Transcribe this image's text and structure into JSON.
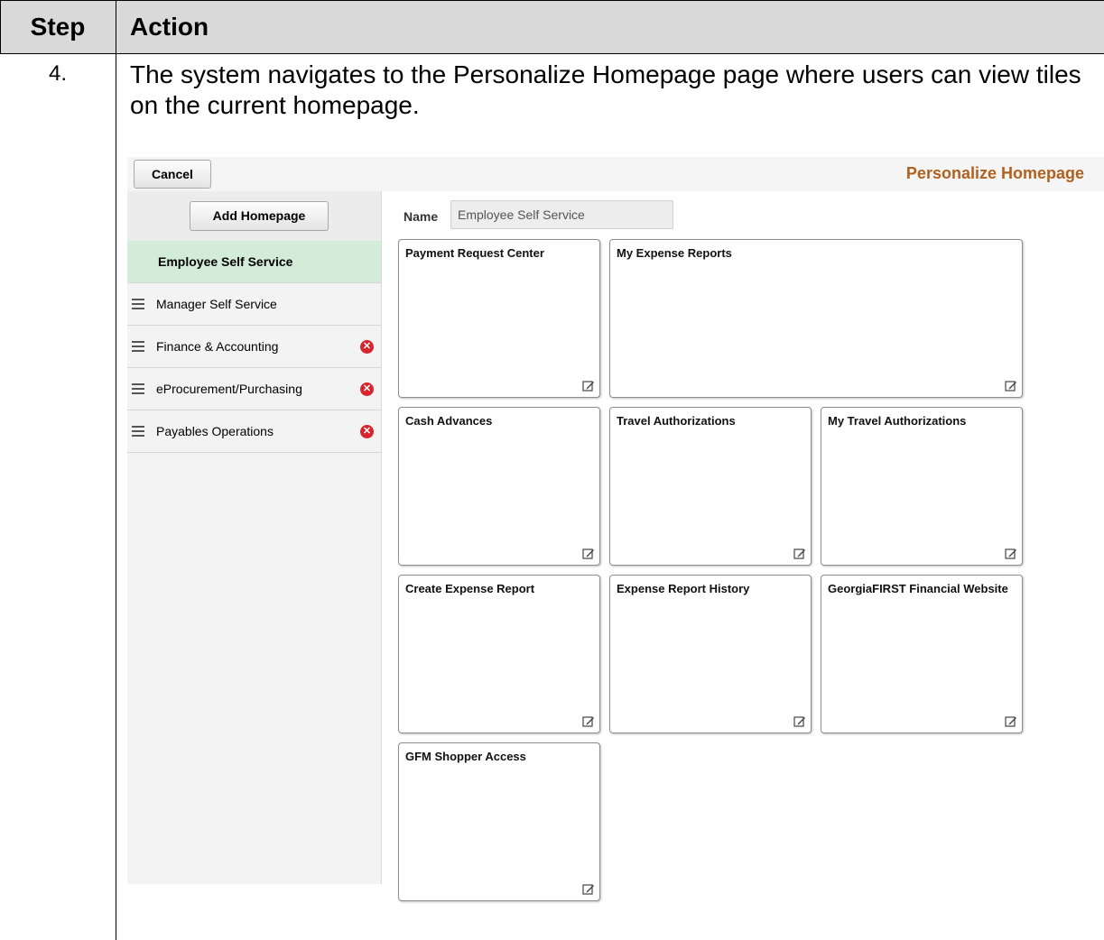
{
  "doc": {
    "header_step": "Step",
    "header_action": "Action",
    "step_number": "4.",
    "step_text": "The system navigates to the Personalize Homepage page where users can view tiles on the current homepage."
  },
  "app": {
    "cancel_label": "Cancel",
    "page_title": "Personalize Homepage",
    "add_homepage_label": "Add Homepage",
    "name_label": "Name",
    "name_value": "Employee Self Service"
  },
  "homepages": [
    {
      "label": "Employee Self Service",
      "active": true,
      "removable": false
    },
    {
      "label": "Manager Self Service",
      "active": false,
      "removable": false
    },
    {
      "label": "Finance & Accounting",
      "active": false,
      "removable": true
    },
    {
      "label": "eProcurement/Purchasing",
      "active": false,
      "removable": true
    },
    {
      "label": "Payables Operations",
      "active": false,
      "removable": true
    }
  ],
  "tiles": [
    {
      "title": "Payment Request Center"
    },
    {
      "title": "My Expense Reports"
    },
    {
      "title": "Cash Advances"
    },
    {
      "title": "Travel Authorizations"
    },
    {
      "title": "My Travel Authorizations"
    },
    {
      "title": "Create Expense Report"
    },
    {
      "title": "Expense Report History"
    },
    {
      "title": "GeorgiaFIRST Financial Website"
    },
    {
      "title": "GFM Shopper Access"
    }
  ],
  "colors": {
    "title_accent": "#b0611f",
    "active_item_bg": "#d2ecd8",
    "remove_icon": "#d8242d",
    "header_bg": "#d9d9d9"
  },
  "icons": {
    "drag": "drag-handle-icon",
    "remove": "remove-circle-icon",
    "edit": "edit-pencil-icon"
  }
}
